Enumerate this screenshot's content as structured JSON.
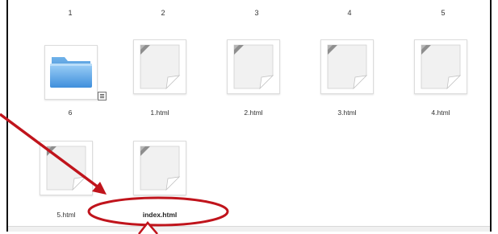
{
  "columns": [
    "1",
    "2",
    "3",
    "4",
    "5"
  ],
  "items": [
    {
      "label": "6",
      "type": "folder"
    },
    {
      "label": "1.html",
      "type": "file"
    },
    {
      "label": "2.html",
      "type": "file"
    },
    {
      "label": "3.html",
      "type": "file"
    },
    {
      "label": "4.html",
      "type": "file"
    },
    {
      "label": "5.html",
      "type": "file"
    },
    {
      "label": "index.html",
      "type": "file",
      "highlighted": true
    }
  ],
  "annotation": {
    "color": "#c0141c",
    "shape": "ellipse-with-arrow"
  }
}
